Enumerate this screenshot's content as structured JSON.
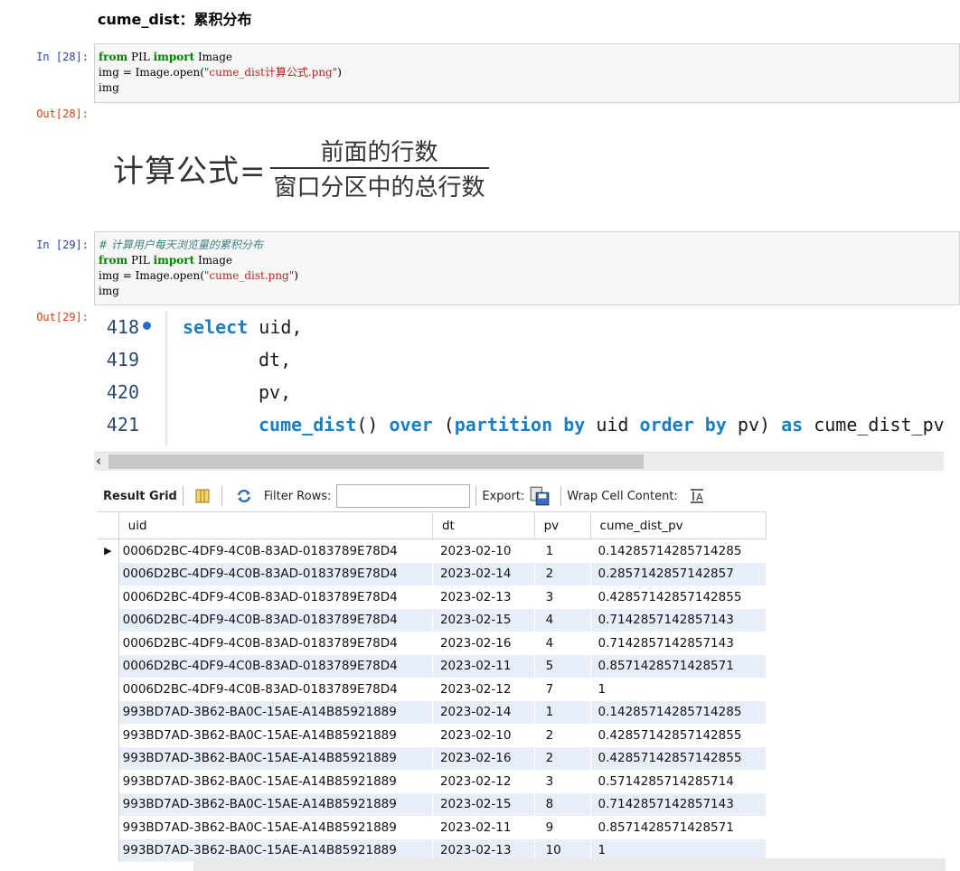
{
  "heading": "cume_dist：累积分布",
  "cells": [
    {
      "in_prompt": "In  [28]:",
      "code": [
        [
          {
            "t": "from",
            "c": "kw"
          },
          {
            "t": " PIL "
          },
          {
            "t": "import",
            "c": "kw"
          },
          {
            "t": " Image"
          }
        ],
        [
          {
            "t": "img = Image.open("
          },
          {
            "t": "\"cume_dist计算公式.png\"",
            "c": "str"
          },
          {
            "t": ")"
          }
        ],
        [
          {
            "t": "img"
          }
        ]
      ],
      "out_prompt": "Out[28]:"
    },
    {
      "in_prompt": "In  [29]:",
      "code": [
        [
          {
            "t": "# 计算用户每天浏览量的累积分布",
            "c": "cm"
          }
        ],
        [
          {
            "t": "from",
            "c": "kw"
          },
          {
            "t": " PIL "
          },
          {
            "t": "import",
            "c": "kw"
          },
          {
            "t": " Image"
          }
        ],
        [
          {
            "t": "img = Image.open("
          },
          {
            "t": "\"cume_dist.png\"",
            "c": "str"
          },
          {
            "t": ")"
          }
        ],
        [
          {
            "t": "img"
          }
        ]
      ],
      "out_prompt": "Out[29]:"
    }
  ],
  "formula": {
    "lhs": "计算公式=",
    "numerator": "前面的行数",
    "denominator": "窗口分区中的总行数"
  },
  "sql": {
    "line_numbers": [
      "418",
      "419",
      "420",
      "421"
    ],
    "lines": [
      [
        {
          "t": "select",
          "c": "sk"
        },
        {
          "t": " uid,"
        }
      ],
      [
        {
          "t": "dt,"
        }
      ],
      [
        {
          "t": "pv,"
        }
      ],
      [
        {
          "t": "cume_dist",
          "c": "sf"
        },
        {
          "t": "() "
        },
        {
          "t": "over",
          "c": "sk"
        },
        {
          "t": " ("
        },
        {
          "t": "partition",
          "c": "sk"
        },
        {
          "t": " "
        },
        {
          "t": "by",
          "c": "sk"
        },
        {
          "t": " uid "
        },
        {
          "t": "order",
          "c": "sk"
        },
        {
          "t": " "
        },
        {
          "t": "by",
          "c": "sk"
        },
        {
          "t": " pv) "
        },
        {
          "t": "as",
          "c": "sk"
        },
        {
          "t": " cume_dist_pv"
        }
      ]
    ]
  },
  "toolbar": {
    "result_grid": "Result Grid",
    "filter_rows": "Filter Rows:",
    "filter_value": "",
    "export": "Export:",
    "wrap": "Wrap Cell Content:"
  },
  "grid": {
    "columns": [
      "uid",
      "dt",
      "pv",
      "cume_dist_pv"
    ],
    "rows": [
      [
        "0006D2BC-4DF9-4C0B-83AD-0183789E78D4",
        "2023-02-10",
        "1",
        "0.14285714285714285"
      ],
      [
        "0006D2BC-4DF9-4C0B-83AD-0183789E78D4",
        "2023-02-14",
        "2",
        "0.2857142857142857"
      ],
      [
        "0006D2BC-4DF9-4C0B-83AD-0183789E78D4",
        "2023-02-13",
        "3",
        "0.42857142857142855"
      ],
      [
        "0006D2BC-4DF9-4C0B-83AD-0183789E78D4",
        "2023-02-15",
        "4",
        "0.7142857142857143"
      ],
      [
        "0006D2BC-4DF9-4C0B-83AD-0183789E78D4",
        "2023-02-16",
        "4",
        "0.7142857142857143"
      ],
      [
        "0006D2BC-4DF9-4C0B-83AD-0183789E78D4",
        "2023-02-11",
        "5",
        "0.8571428571428571"
      ],
      [
        "0006D2BC-4DF9-4C0B-83AD-0183789E78D4",
        "2023-02-12",
        "7",
        "1"
      ],
      [
        "993BD7AD-3B62-BA0C-15AE-A14B85921889",
        "2023-02-14",
        "1",
        "0.14285714285714285"
      ],
      [
        "993BD7AD-3B62-BA0C-15AE-A14B85921889",
        "2023-02-10",
        "2",
        "0.42857142857142855"
      ],
      [
        "993BD7AD-3B62-BA0C-15AE-A14B85921889",
        "2023-02-16",
        "2",
        "0.42857142857142855"
      ],
      [
        "993BD7AD-3B62-BA0C-15AE-A14B85921889",
        "2023-02-12",
        "3",
        "0.5714285714285714"
      ],
      [
        "993BD7AD-3B62-BA0C-15AE-A14B85921889",
        "2023-02-15",
        "8",
        "0.7142857142857143"
      ],
      [
        "993BD7AD-3B62-BA0C-15AE-A14B85921889",
        "2023-02-11",
        "9",
        "0.8571428571428571"
      ],
      [
        "993BD7AD-3B62-BA0C-15AE-A14B85921889",
        "2023-02-13",
        "10",
        "1"
      ]
    ]
  },
  "colors": {
    "in_prompt": "#303f9f",
    "out_prompt": "#d84315",
    "keyword": "#008000",
    "string": "#ba2121",
    "sql_keyword": "#1a7fbf",
    "row_alt": "#e8eef8"
  }
}
